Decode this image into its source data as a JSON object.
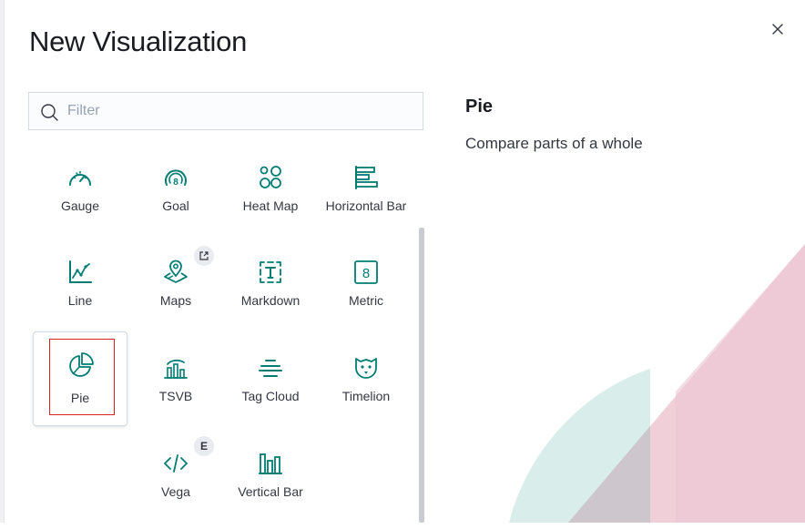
{
  "dialog": {
    "title": "New Visualization",
    "close_icon": "close-icon"
  },
  "search": {
    "placeholder": "Filter",
    "value": "",
    "icon": "search-icon"
  },
  "types": [
    {
      "label": "Gauge",
      "icon": "gauge-icon"
    },
    {
      "label": "Goal",
      "icon": "goal-icon"
    },
    {
      "label": "Heat Map",
      "icon": "heatmap-icon"
    },
    {
      "label": "Horizontal Bar",
      "icon": "horizontal-bar-icon"
    },
    {
      "label": "Line",
      "icon": "line-chart-icon"
    },
    {
      "label": "Maps",
      "icon": "maps-icon",
      "badge_icon": "external-link-icon"
    },
    {
      "label": "Markdown",
      "icon": "markdown-icon"
    },
    {
      "label": "Metric",
      "icon": "metric-icon"
    },
    {
      "label": "Pie",
      "icon": "pie-icon",
      "selected": true
    },
    {
      "label": "TSVB",
      "icon": "tsvb-icon"
    },
    {
      "label": "Tag Cloud",
      "icon": "tag-cloud-icon"
    },
    {
      "label": "Timelion",
      "icon": "timelion-icon"
    },
    {
      "label": "Vega",
      "icon": "vega-code-icon",
      "badge": "E"
    },
    {
      "label": "Vertical Bar",
      "icon": "vertical-bar-icon"
    }
  ],
  "description": {
    "title": "Pie",
    "text": "Compare parts of a whole"
  },
  "colors": {
    "icon_teal": "#017d73",
    "selection_outline": "#d62424",
    "illustration_pink": "#f0cfd9",
    "illustration_mint": "#d9eeea"
  }
}
